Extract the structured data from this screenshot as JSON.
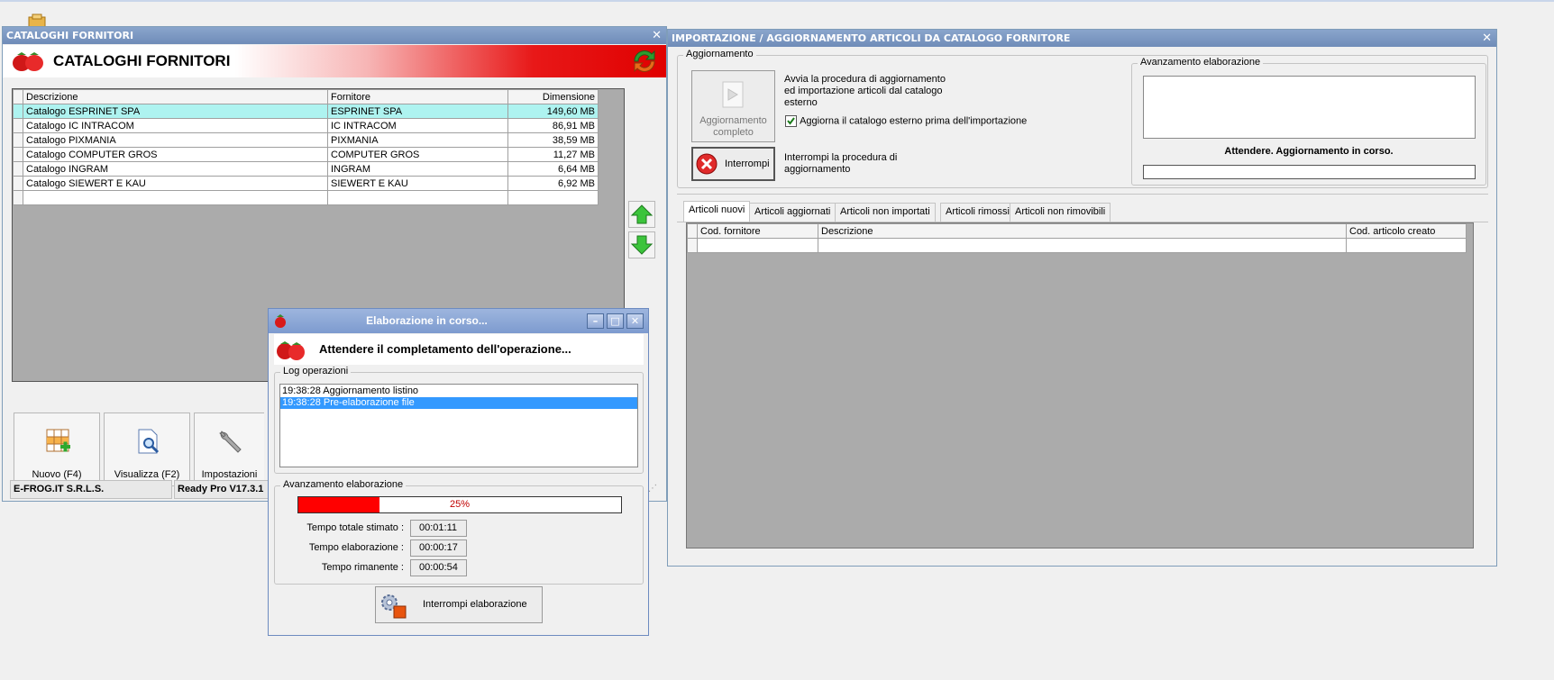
{
  "cataloghi": {
    "window_title": "CATALOGHI FORNITORI",
    "header_title": "CATALOGHI FORNITORI",
    "columns": [
      "Descrizione",
      "Fornitore",
      "Dimensione"
    ],
    "rows": [
      {
        "descrizione": "Catalogo ESPRINET SPA",
        "fornitore": "ESPRINET SPA",
        "dimensione": "149,60 MB"
      },
      {
        "descrizione": "Catalogo IC INTRACOM",
        "fornitore": "IC INTRACOM",
        "dimensione": "86,91 MB"
      },
      {
        "descrizione": "Catalogo PIXMANIA",
        "fornitore": "PIXMANIA",
        "dimensione": "38,59 MB"
      },
      {
        "descrizione": "Catalogo COMPUTER GROS",
        "fornitore": "COMPUTER GROS",
        "dimensione": "11,27 MB"
      },
      {
        "descrizione": "Catalogo INGRAM",
        "fornitore": "INGRAM",
        "dimensione": "6,64 MB"
      },
      {
        "descrizione": "Catalogo SIEWERT E KAU",
        "fornitore": "SIEWERT E KAU",
        "dimensione": "6,92 MB"
      }
    ],
    "buttons": {
      "nuovo": "Nuovo (F4)",
      "visualizza": "Visualizza (F2)",
      "impostazioni": "Impostazioni"
    },
    "status": {
      "company": "E-FROG.IT S.R.L.S.",
      "version": "Ready Pro V17.3.1"
    }
  },
  "importazione": {
    "window_title": "IMPORTAZIONE / AGGIORNAMENTO ARTICOLI DA CATALOGO FORNITORE",
    "aggiornamento_group": "Aggiornamento",
    "aggiornamento_btn": "Aggiornamento completo",
    "aggiornamento_desc": "Avvia la procedura di aggiornamento ed importazione articoli dal catalogo esterno",
    "checkbox_label": "Aggiorna il catalogo esterno prima dell'importazione",
    "checkbox_checked": true,
    "interrompi_btn": "Interrompi",
    "interrompi_desc": "Interrompi la procedura di aggiornamento",
    "avanzamento_group": "Avanzamento elaborazione",
    "attendere": "Attendere. Aggiornamento in corso.",
    "tabs": [
      "Articoli nuovi",
      "Articoli aggiornati",
      "Articoli non importati",
      "Articoli rimossi",
      "Articoli non rimovibili"
    ],
    "active_tab": "Articoli nuovi",
    "table_columns": [
      "Cod. fornitore",
      "Descrizione",
      "Cod. articolo creato"
    ]
  },
  "dialog": {
    "title": "Elaborazione in corso...",
    "message": "Attendere il completamento dell'operazione...",
    "log_group": "Log operazioni",
    "log": [
      "19:38:28 Aggiornamento listino",
      "19:38:28 Pre-elaborazione file"
    ],
    "avanzamento_group": "Avanzamento elaborazione",
    "progress_percent": 25,
    "progress_label": "25%",
    "tempo_totale_label": "Tempo totale stimato :",
    "tempo_totale": "00:01:11",
    "tempo_elaborazione_label": "Tempo elaborazione :",
    "tempo_elaborazione": "00:00:17",
    "tempo_rimanente_label": "Tempo rimanente :",
    "tempo_rimanente": "00:00:54",
    "interrompi_btn": "Interrompi elaborazione"
  },
  "colors": {
    "accent_red": "#e00000",
    "selection": "#aef3f0",
    "log_selection": "#3399ff"
  }
}
